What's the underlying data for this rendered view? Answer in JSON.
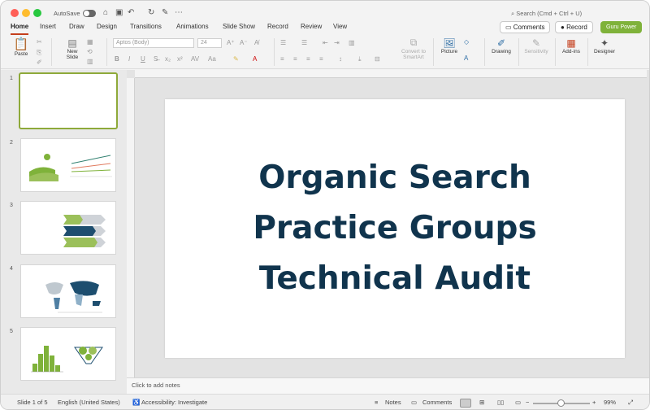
{
  "titlebar": {
    "autosave_label": "AutoSave",
    "search_placeholder": "Search (Cmd + Ctrl + U)"
  },
  "tabs": [
    "Home",
    "Insert",
    "Draw",
    "Design",
    "Transitions",
    "Animations",
    "Slide Show",
    "Record",
    "Review",
    "View"
  ],
  "active_tab": "Home",
  "header_buttons": {
    "comments": "Comments",
    "record": "Record",
    "guru": "Guru Power"
  },
  "ribbon": {
    "paste": "Paste",
    "new_slide": "New Slide",
    "font_name": "Aptos (Body)",
    "font_size": "24",
    "convert": "Convert to SmartArt",
    "picture": "Picture",
    "drawing": "Drawing",
    "sensitivity": "Sensitivity",
    "addins": "Add-ins",
    "designer": "Designer"
  },
  "slides": {
    "numbers": [
      "1",
      "2",
      "3",
      "4",
      "5"
    ],
    "selected": 1
  },
  "slide": {
    "line1": "Organic Search",
    "line2": "Practice Groups",
    "line3": "Technical Audit",
    "text_color": "#10344d"
  },
  "notes_placeholder": "Click to add notes",
  "status": {
    "slide_of": "Slide 1 of 5",
    "language": "English (United States)",
    "accessibility": "Accessibility: Investigate",
    "notes": "Notes",
    "comments": "Comments",
    "zoom": "99%"
  },
  "colors": {
    "accent_green": "#7fb23a",
    "tab_underline": "#c43e1c"
  }
}
